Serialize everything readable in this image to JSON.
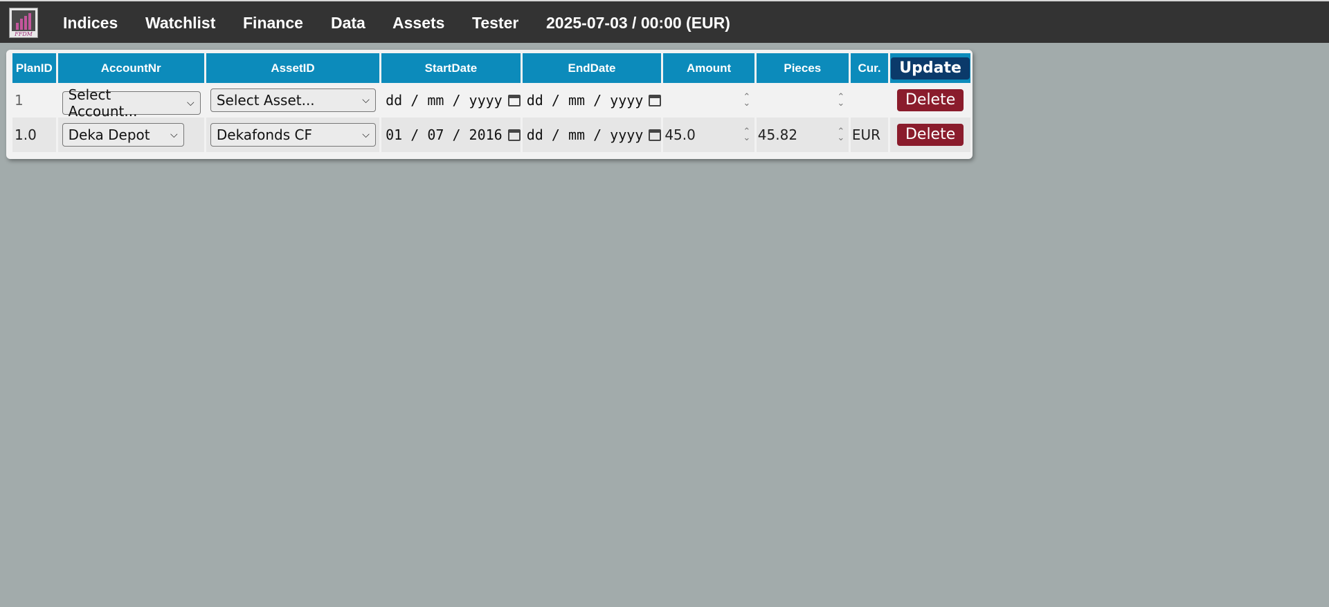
{
  "nav": {
    "logo_text": "FFDM",
    "items": [
      "Indices",
      "Watchlist",
      "Finance",
      "Data",
      "Assets",
      "Tester"
    ],
    "status": "2025-07-03 / 00:00 (EUR)"
  },
  "table": {
    "headers": [
      "PlanID",
      "AccountNr",
      "AssetID",
      "StartDate",
      "EndDate",
      "Amount",
      "Pieces",
      "Cur."
    ],
    "update_label": "Update",
    "rows": [
      {
        "plan_id": "1",
        "account": "Select Account...",
        "asset": "Select Asset...",
        "start_d": "dd",
        "start_m": "mm",
        "start_y": "yyyy",
        "end_d": "dd",
        "end_m": "mm",
        "end_y": "yyyy",
        "amount": "",
        "pieces": "",
        "currency": "",
        "delete_label": "Delete"
      },
      {
        "plan_id": "1.0",
        "account": "Deka Depot",
        "asset": "Dekafonds CF",
        "start_d": "01",
        "start_m": "07",
        "start_y": "2016",
        "end_d": "dd",
        "end_m": "mm",
        "end_y": "yyyy",
        "amount": "45.0",
        "pieces": "45.82",
        "currency": "EUR",
        "delete_label": "Delete"
      }
    ]
  },
  "colors": {
    "topbar": "#333333",
    "header_bg": "#0c8bbb",
    "update_btn": "#0b3a6a",
    "delete_btn": "#8a1c2c",
    "page_bg": "#a2abab"
  }
}
